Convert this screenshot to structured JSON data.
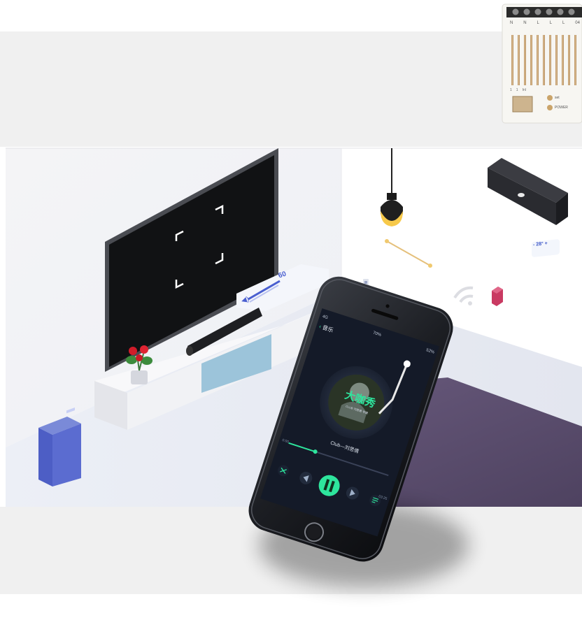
{
  "module": {
    "terminals": [
      "N",
      "N",
      "L",
      "L",
      "L",
      "04"
    ],
    "led1_label": "set",
    "led2_label": "POWER",
    "left_marks": [
      "1",
      "1",
      "Inl"
    ]
  },
  "tv": {
    "volume_label": "60"
  },
  "thermostat": {
    "temp_label": "- 28° +"
  },
  "phone": {
    "status_left": "4G",
    "status_center": "70%",
    "status_right": "52%",
    "back_label": "音乐",
    "album_title": "大咖秀",
    "album_subtitle": "CLUB·刘思倩 专辑",
    "song_title": "Club—刘思倩",
    "time_current": "0:00",
    "time_total": "03:25"
  },
  "colors": {
    "accent_green": "#2ee59d",
    "screen_bg": "#141a28",
    "floor_purple": "#5b4e6d",
    "speaker_blue": "#5866c8",
    "lamp_yellow": "#f7c94a"
  }
}
